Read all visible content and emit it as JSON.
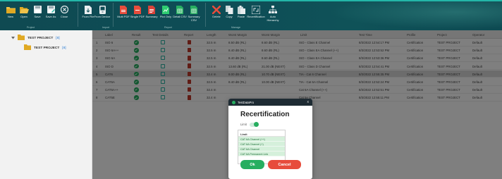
{
  "ribbon": {
    "buttons": [
      {
        "label": "New",
        "icon": "folder-new-icon"
      },
      {
        "label": "Open",
        "icon": "folder-open-icon"
      },
      {
        "label": "Save",
        "icon": "save-icon"
      },
      {
        "label": "Save As",
        "icon": "save-as-icon"
      },
      {
        "label": "Close",
        "icon": "close-circle-icon"
      },
      {
        "label": "From File",
        "icon": "import-file-icon"
      },
      {
        "label": "From Device",
        "icon": "import-device-icon"
      },
      {
        "label": "Multi PDF",
        "icon": "pdf-icon"
      },
      {
        "label": "Single PDF",
        "icon": "pdf-icon"
      },
      {
        "label": "Summary",
        "icon": "summary-pdf-icon"
      },
      {
        "label": "Plot Only",
        "icon": "plot-icon"
      },
      {
        "label": "Detail CSV",
        "icon": "csv-icon"
      },
      {
        "label": "Summary CSV",
        "icon": "csv-icon"
      },
      {
        "label": "Delete",
        "icon": "delete-x-icon"
      },
      {
        "label": "Copy",
        "icon": "copy-icon"
      },
      {
        "label": "Paste",
        "icon": "paste-icon"
      },
      {
        "label": "Recertification",
        "icon": "recertification-icon"
      },
      {
        "label": "Auto Hierarchy",
        "icon": "hierarchy-icon"
      }
    ],
    "groups": [
      "Project",
      "Import",
      "Report",
      "Manage"
    ],
    "colors": {
      "ribbon": "#0e4d56",
      "accent": "#23b6a8"
    }
  },
  "tree": {
    "items": [
      {
        "name": "TEST PROJECT",
        "count": "[8]"
      },
      {
        "name": "TEST PROJECT",
        "count": "[8]"
      }
    ]
  },
  "table": {
    "headers": [
      "Label",
      "Result",
      "Test Details",
      "Report",
      "Length",
      "Worst Margin",
      "Worst Margin",
      "Limit",
      "Test Time",
      "Profile",
      "Project",
      "Operator"
    ],
    "rows": [
      {
        "num": "1",
        "label": "ISO 6",
        "length": "32.5 m",
        "wm1": "8.50 dB (RL)",
        "wm2": "8.60 dB (RL)",
        "limit": "ISO - Class E Channel",
        "time": "8/3/2022 12:54:17 PM",
        "profile": "Certification",
        "project": "TEST PROJECT",
        "operator": "Default"
      },
      {
        "num": "2",
        "label": "ISO 6A++",
        "length": "32.5 m",
        "wm1": "8.40 dB (RL)",
        "wm2": "8.60 dB (RL)",
        "limit": "ISO - Class EA Channel (++)",
        "time": "8/3/2022 12:53:52 PM",
        "profile": "Certification",
        "project": "TEST PROJECT",
        "operator": "Default"
      },
      {
        "num": "3",
        "label": "ISO 6A",
        "length": "32.5 m",
        "wm1": "8.40 dB (RL)",
        "wm2": "8.60 dB (RL)",
        "limit": "ISO - Class EA Channel",
        "time": "8/3/2022 12:53:36 PM",
        "profile": "Certification",
        "project": "TEST PROJECT",
        "operator": "Default"
      },
      {
        "num": "4",
        "label": "ISO D",
        "length": "32.5 m",
        "wm1": "13.60 dB (RL)",
        "wm2": "21.00 dB (NEXT)",
        "limit": "ISO - Class D Channel",
        "time": "8/3/2022 12:54:41 PM",
        "profile": "Certification",
        "project": "TEST PROJECT",
        "operator": "Default"
      },
      {
        "num": "5",
        "label": "CAT6",
        "length": "32.4 m",
        "wm1": "8.00 dB (RL)",
        "wm2": "10.70 dB (NEXT)",
        "limit": "TIA - Cat 6 Channel",
        "time": "8/3/2022 12:55:35 PM",
        "profile": "Certification",
        "project": "TEST PROJECT",
        "operator": "Default"
      },
      {
        "num": "6",
        "label": "CAT6A",
        "length": "32.5 m",
        "wm1": "8.40 dB (RL)",
        "wm2": "10.00 dB (NEXT)",
        "limit": "TIA - Cat 6A Channel",
        "time": "8/3/2022 12:52:24 PM",
        "profile": "Certification",
        "project": "TEST PROJECT",
        "operator": "Default"
      },
      {
        "num": "7",
        "label": "CAT6A++",
        "length": "32.4 m",
        "wm1": "",
        "wm2": "",
        "limit": "Cat 6A Channel (++)",
        "time": "8/3/2022 12:52:51 PM",
        "profile": "Certification",
        "project": "TEST PROJECT",
        "operator": "Default"
      },
      {
        "num": "8",
        "label": "CAT5E",
        "length": "32.4 m",
        "wm1": "",
        "wm2": "",
        "limit": "Cat 5e Channel",
        "time": "8/3/2022 12:55:11 PM",
        "profile": "Certification",
        "project": "TEST PROJECT",
        "operator": "Default"
      }
    ]
  },
  "dialog": {
    "app_name": "TestDataPro",
    "close": "x",
    "title": "Recertification",
    "limit_label": "Limit",
    "limit_header": "Limit",
    "limit_options": [
      "CAT 6A Channel (++)",
      "CAT 6A Channel (+)",
      "CAT 6A Channel",
      "CAT 6A Permanent Link"
    ],
    "ok_label": "Ok",
    "cancel_label": "Cancel",
    "colors": {
      "ok": "#27ae60",
      "cancel": "#e74c3c"
    }
  }
}
